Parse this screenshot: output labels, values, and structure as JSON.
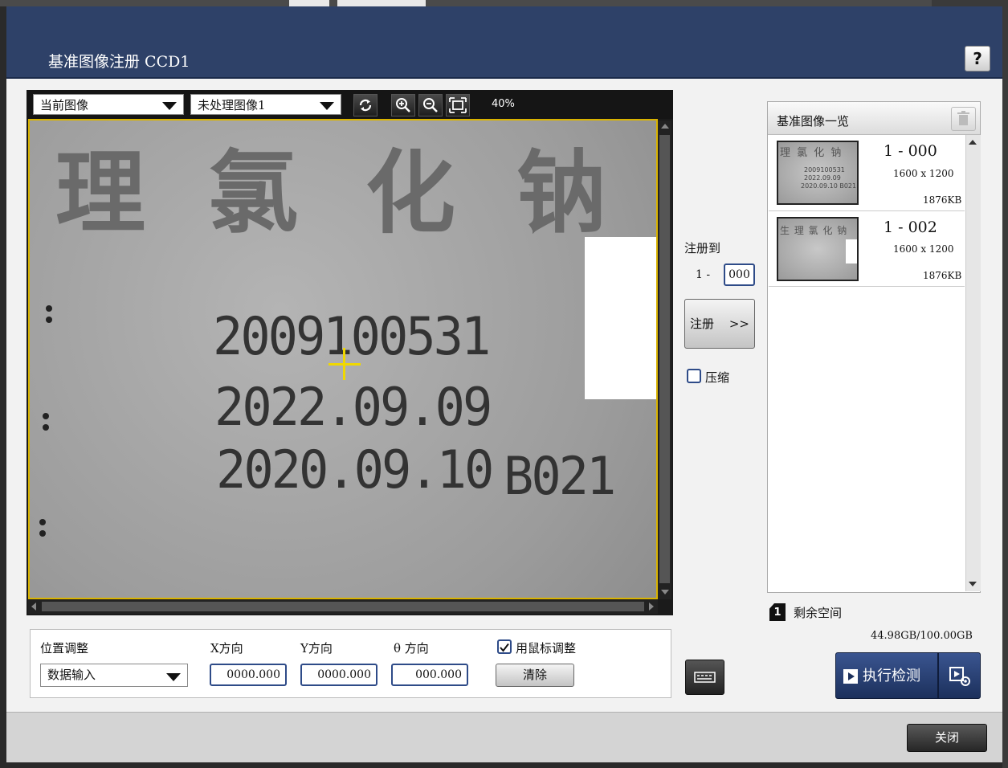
{
  "dialog": {
    "title": "基准图像注册 CCD1",
    "help_label": "?",
    "close_label": "关闭"
  },
  "viewer": {
    "source_select": "当前图像",
    "process_select": "未处理图像1",
    "zoom_level": "40%"
  },
  "image_text": {
    "header_chars": [
      "理",
      "氯",
      "化",
      "钠"
    ],
    "line1": "2009100531",
    "line2": "2022.09.09",
    "line3": "2020.09.10",
    "line3_code": "B021"
  },
  "position": {
    "title": "位置调整",
    "mode_select": "数据输入",
    "x_label": "X方向",
    "y_label": "Y方向",
    "theta_label": "θ 方向",
    "x_value": "0000.000",
    "y_value": "0000.000",
    "theta_value": "000.000",
    "mouse_adjust_label": "用鼠标调整",
    "mouse_adjust_checked": true,
    "clear_label": "清除"
  },
  "register": {
    "title": "注册到",
    "prefix": "1 -",
    "slot_value": "000",
    "button_label": "注册",
    "button_arrow": ">>",
    "compress_label": "压缩",
    "compress_checked": false
  },
  "list": {
    "title": "基准图像一览",
    "items": [
      {
        "id": "1 - 000",
        "size": "1600 x 1200",
        "file_size": "1876KB",
        "thumb_text": "理 氯 化 钠",
        "thumb_lines": [
          "2009100531",
          "2022.09.09",
          "2020.09.10 B021"
        ]
      },
      {
        "id": "1 - 002",
        "size": "1600 x 1200",
        "file_size": "1876KB",
        "thumb_text": "生 理 氯 化 钠",
        "thumb_lines": []
      }
    ]
  },
  "storage": {
    "label": "剩余空间",
    "icon_label": "1",
    "value": "44.98GB/100.00GB"
  },
  "execute": {
    "label": "执行检测"
  }
}
